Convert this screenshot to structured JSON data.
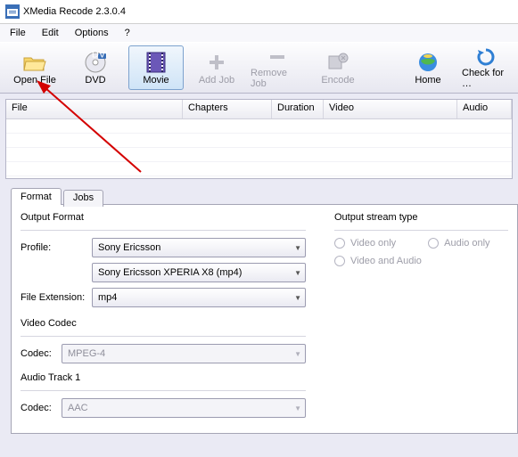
{
  "title": "XMedia Recode 2.3.0.4",
  "menu": {
    "file": "File",
    "edit": "Edit",
    "options": "Options",
    "help": "?"
  },
  "toolbar": {
    "open_file": "Open File",
    "dvd": "DVD",
    "movie": "Movie",
    "add_job": "Add Job",
    "remove_job": "Remove Job",
    "encode": "Encode",
    "home": "Home",
    "check": "Check for …"
  },
  "table": {
    "file": "File",
    "chapters": "Chapters",
    "duration": "Duration",
    "video": "Video",
    "audio": "Audio"
  },
  "tabs": {
    "format": "Format",
    "jobs": "Jobs"
  },
  "format": {
    "output_format": "Output Format",
    "profile": "Profile:",
    "profile_value": "Sony Ericsson",
    "model_value": "Sony Ericsson XPERIA X8 (mp4)",
    "ext_label": "File Extension:",
    "ext_value": "mp4",
    "video_codec": "Video Codec",
    "codec": "Codec:",
    "vcodec_value": "MPEG-4",
    "audio_track": "Audio Track 1",
    "acodec_value": "AAC"
  },
  "stream": {
    "title": "Output stream type",
    "video_only": "Video only",
    "audio_only": "Audio only",
    "video_audio": "Video and Audio"
  }
}
